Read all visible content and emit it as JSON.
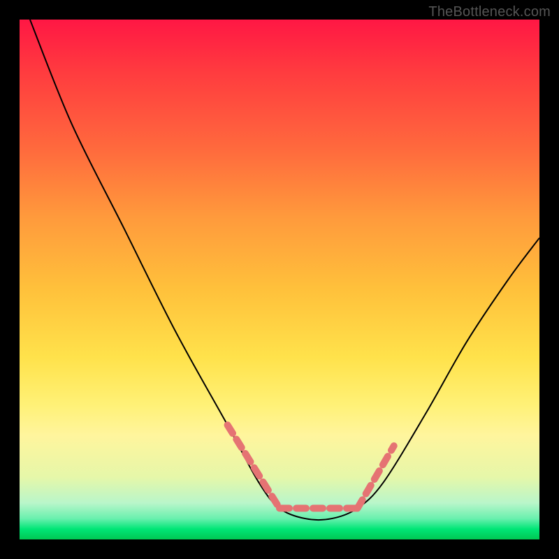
{
  "watermark": "TheBottleneck.com",
  "chart_data": {
    "type": "line",
    "title": "",
    "xlabel": "",
    "ylabel": "",
    "xlim": [
      0,
      1
    ],
    "ylim": [
      0,
      1
    ],
    "series": [
      {
        "name": "curve",
        "x": [
          0.02,
          0.1,
          0.2,
          0.3,
          0.4,
          0.46,
          0.5,
          0.55,
          0.6,
          0.65,
          0.7,
          0.78,
          0.86,
          0.94,
          1.0
        ],
        "y": [
          1.0,
          0.8,
          0.6,
          0.4,
          0.22,
          0.11,
          0.06,
          0.04,
          0.04,
          0.06,
          0.11,
          0.24,
          0.38,
          0.5,
          0.58
        ]
      },
      {
        "name": "dashed-left",
        "x": [
          0.4,
          0.5
        ],
        "y": [
          0.22,
          0.06
        ]
      },
      {
        "name": "dashed-bottom",
        "x": [
          0.5,
          0.65
        ],
        "y": [
          0.06,
          0.06
        ]
      },
      {
        "name": "dashed-right",
        "x": [
          0.65,
          0.72
        ],
        "y": [
          0.06,
          0.18
        ]
      }
    ],
    "colors": {
      "curve": "#000000",
      "dashed": "#e57373",
      "gradient_top": "#ff1744",
      "gradient_mid": "#ffe24b",
      "gradient_bottom": "#00c853"
    }
  }
}
